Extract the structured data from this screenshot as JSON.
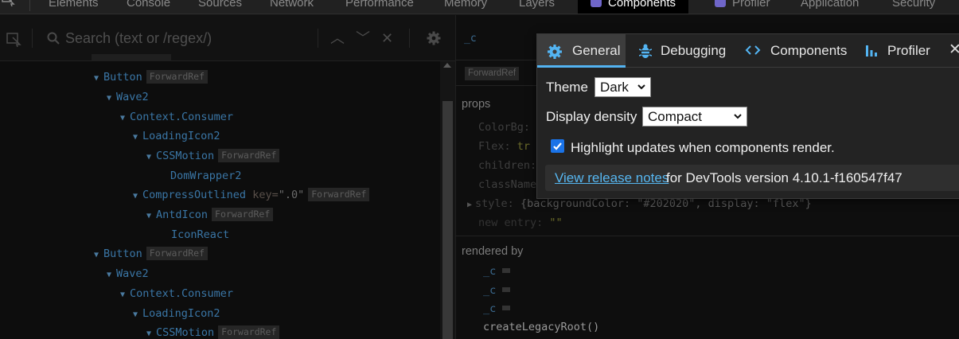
{
  "devtools_tabs": [
    {
      "label": "Elements"
    },
    {
      "label": "Console"
    },
    {
      "label": "Sources"
    },
    {
      "label": "Network"
    },
    {
      "label": "Performance"
    },
    {
      "label": "Memory"
    },
    {
      "label": "Layers"
    },
    {
      "label": "Components",
      "active": true
    },
    {
      "label": "Profiler"
    },
    {
      "label": "Application"
    },
    {
      "label": "Security"
    }
  ],
  "tree": {
    "search_placeholder": "Search (text or /regex/)",
    "rows": [
      {
        "name": "Button",
        "badge": "ForwardRef"
      },
      {
        "name": "Wave2"
      },
      {
        "name": "Context.Consumer"
      },
      {
        "name": "LoadingIcon2"
      },
      {
        "name": "CSSMotion",
        "badge": "ForwardRef"
      },
      {
        "name": "DomWrapper2"
      },
      {
        "name": "CompressOutlined",
        "key_label": "key=",
        "key_value": "\".0\"",
        "badge": "ForwardRef"
      },
      {
        "name": "AntdIcon",
        "badge": "ForwardRef"
      },
      {
        "name": "IconReact"
      },
      {
        "name": "Button",
        "badge": "ForwardRef"
      },
      {
        "name": "Wave2"
      },
      {
        "name": "Context.Consumer"
      },
      {
        "name": "LoadingIcon2"
      },
      {
        "name": "CSSMotion",
        "badge": "ForwardRef"
      }
    ]
  },
  "side": {
    "title": "_c",
    "badge": "ForwardRef",
    "props_label": "props",
    "props": [
      {
        "key": "ColorBg:",
        "value": ""
      },
      {
        "key": "Flex:",
        "value": "tr"
      },
      {
        "key": "children:",
        "value": ""
      },
      {
        "key": "className",
        "value": ""
      },
      {
        "key": "style:",
        "value": "{backgroundColor: \"#202020\", display: \"flex\"}"
      },
      {
        "key": "new entry:",
        "value": "\"\""
      }
    ],
    "rendered_by_label": "rendered by",
    "rendered_by": [
      "_c",
      "_c",
      "_c",
      "createLegacyRoot()"
    ]
  },
  "modal": {
    "tabs": [
      {
        "label": "General",
        "icon": "gear-icon",
        "active": true
      },
      {
        "label": "Debugging",
        "icon": "bug-icon"
      },
      {
        "label": "Components",
        "icon": "code-icon"
      },
      {
        "label": "Profiler",
        "icon": "bar-chart-icon"
      }
    ],
    "close_label": "✕",
    "theme_label": "Theme",
    "theme_value": "Dark",
    "density_label": "Display density",
    "density_value": "Compact",
    "highlight_label": "Highlight updates when components render.",
    "highlight_checked": true,
    "release_link": "View release notes",
    "release_text": "for DevTools version 4.10.1-f160547f47"
  },
  "colors": {
    "accent": "#53b4f2",
    "checkbox": "#1a73e8",
    "react_badge": "#6f66c9"
  }
}
